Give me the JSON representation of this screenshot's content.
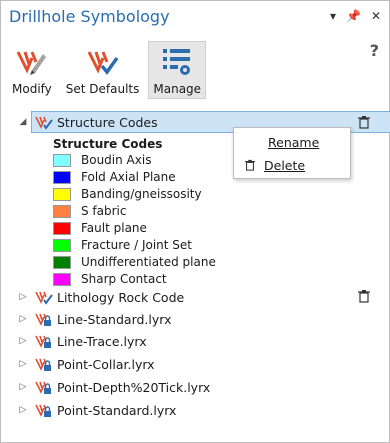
{
  "pane": {
    "title": "Drillhole Symbology",
    "title_buttons": [
      "▾",
      "📌",
      "✕"
    ],
    "help": "?"
  },
  "toolbar": {
    "modify_label": "Modify",
    "set_defaults_label": "Set Defaults",
    "manage_label": "Manage"
  },
  "tree": {
    "selected": {
      "label": "Structure Codes"
    },
    "legend_title": "Structure Codes",
    "legend": [
      {
        "label": "Boudin Axis",
        "color": "#7fffff"
      },
      {
        "label": "Fold Axial Plane",
        "color": "#0000ff"
      },
      {
        "label": "Banding/gneissosity",
        "color": "#ffff00"
      },
      {
        "label": "S fabric",
        "color": "#ff8040"
      },
      {
        "label": "Fault plane",
        "color": "#ff0000"
      },
      {
        "label": "Fracture / Joint Set",
        "color": "#00ff00"
      },
      {
        "label": "Undifferentiated plane",
        "color": "#008000"
      },
      {
        "label": "Sharp Contact",
        "color": "#ff00ff"
      }
    ],
    "items": [
      {
        "label": "Lithology Rock Code"
      },
      {
        "label": "Line-Standard.lyrx"
      },
      {
        "label": "Line-Trace.lyrx"
      },
      {
        "label": "Point-Collar.lyrx"
      },
      {
        "label": "Point-Depth%20Tick.lyrx"
      },
      {
        "label": "Point-Standard.lyrx"
      }
    ]
  },
  "context_menu": {
    "rename_label": "Rename",
    "delete_label": "Delete"
  }
}
